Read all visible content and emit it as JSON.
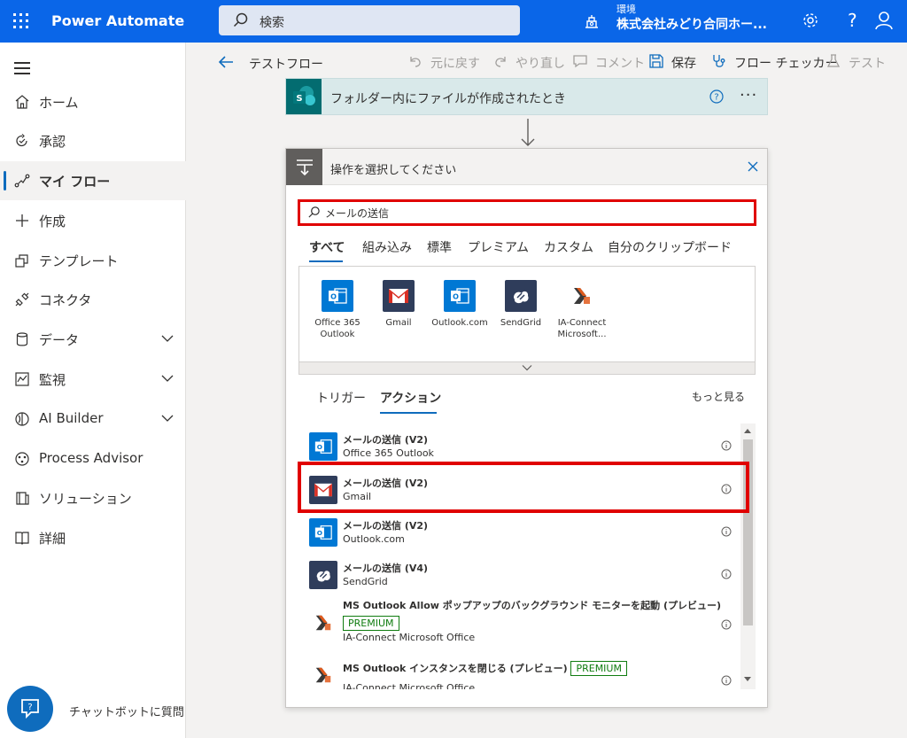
{
  "topbar": {
    "app_name": "Power Automate",
    "search_placeholder": "検索",
    "env_label": "環境",
    "env_name": "株式会社みどり合同ホー...",
    "help": "?"
  },
  "sidebar": {
    "items": [
      {
        "label": "ホーム",
        "icon": "home-icon"
      },
      {
        "label": "承認",
        "icon": "approvals-icon"
      },
      {
        "label": "マイ フロー",
        "icon": "flow-icon",
        "active": true
      },
      {
        "label": "作成",
        "icon": "plus-icon"
      },
      {
        "label": "テンプレート",
        "icon": "template-icon"
      },
      {
        "label": "コネクタ",
        "icon": "connector-icon"
      },
      {
        "label": "データ",
        "icon": "database-icon",
        "expandable": true
      },
      {
        "label": "監視",
        "icon": "monitor-icon",
        "expandable": true
      },
      {
        "label": "AI Builder",
        "icon": "ai-builder-icon",
        "expandable": true
      },
      {
        "label": "Process Advisor",
        "icon": "process-advisor-icon"
      },
      {
        "label": "ソリューション",
        "icon": "solution-icon"
      },
      {
        "label": "詳細",
        "icon": "book-icon"
      }
    ],
    "chatbot_label": "チャットボットに質問"
  },
  "commandbar": {
    "flow_title": "テストフロー",
    "undo": "元に戻す",
    "redo": "やり直し",
    "comment": "コメント",
    "save": "保存",
    "checker": "フロー チェッカー",
    "test": "テスト"
  },
  "trigger": {
    "title": "フォルダー内にファイルが作成されたとき",
    "more": "···"
  },
  "picker": {
    "title": "操作を選択してください",
    "search_value": "メールの送信",
    "filter_tabs": [
      "すべて",
      "組み込み",
      "標準",
      "プレミアム",
      "カスタム",
      "自分のクリップボード"
    ],
    "connectors": [
      {
        "label": "Office 365 Outlook",
        "icon": "office365-outlook-icon"
      },
      {
        "label": "Gmail",
        "icon": "gmail-icon"
      },
      {
        "label": "Outlook.com",
        "icon": "outlook-com-icon"
      },
      {
        "label": "SendGrid",
        "icon": "sendgrid-icon"
      },
      {
        "label": "IA-Connect Microsoft...",
        "icon": "ia-connect-icon"
      }
    ],
    "sub_tabs": [
      "トリガー",
      "アクション"
    ],
    "see_more": "もっと見る",
    "results": [
      {
        "title": "メールの送信 (V2)",
        "connector": "Office 365 Outlook",
        "icon": "office365-outlook-icon"
      },
      {
        "title": "メールの送信 (V2)",
        "connector": "Gmail",
        "icon": "gmail-icon"
      },
      {
        "title": "メールの送信 (V2)",
        "connector": "Outlook.com",
        "icon": "outlook-com-icon"
      },
      {
        "title": "メールの送信 (V4)",
        "connector": "SendGrid",
        "icon": "sendgrid-icon"
      },
      {
        "title": "MS Outlook Allow ポップアップのバックグラウンド モニターを起動 (プレビュー)",
        "badge": "PREMIUM",
        "connector": "IA-Connect Microsoft Office",
        "icon": "ia-connect-icon"
      },
      {
        "title": "MS Outlook インスタンスを閉じる (プレビュー)",
        "badge": "PREMIUM",
        "connector": "IA-Connect Microsoft Office",
        "icon": "ia-connect-icon"
      }
    ]
  },
  "colors": {
    "topbar": "#0a66e8",
    "accent": "#0f6cbd",
    "highlight": "#e00000",
    "premium": "#107c10"
  }
}
